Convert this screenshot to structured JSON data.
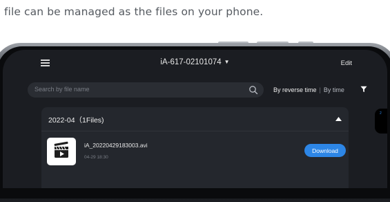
{
  "caption": "file can be managed as the files on your phone.",
  "header": {
    "device_title": "iA-617-02101074",
    "edit_label": "Edit"
  },
  "search": {
    "placeholder": "Search by file name"
  },
  "sort": {
    "active_label": "By reverse time",
    "alt_label": "By time"
  },
  "group": {
    "title": "2022-04（1Files)",
    "expanded": true,
    "files": [
      {
        "name": "iA_20220429183003.avi",
        "timestamp": "04-29 18:30",
        "action_label": "Download"
      }
    ]
  },
  "scroll_indicator": "2",
  "colors": {
    "screen_bg": "#1b1d22",
    "card_bg": "#24272d",
    "accent": "#2d86e6",
    "text_primary": "#e8e8e8",
    "text_muted": "#7a7e86"
  }
}
